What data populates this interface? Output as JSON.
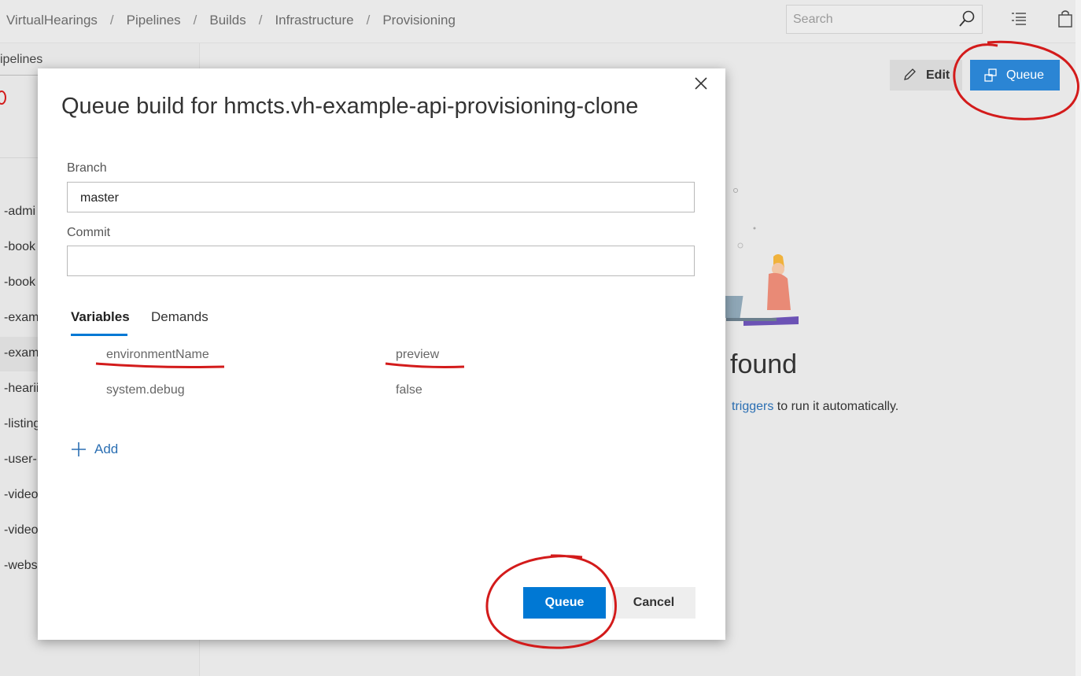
{
  "header": {
    "breadcrumbs": [
      "VirtualHearings",
      "Pipelines",
      "Builds",
      "Infrastructure",
      "Provisioning"
    ],
    "search_placeholder": "Search"
  },
  "sidebar": {
    "title": "ipelines",
    "items": [
      {
        "label": "-admi"
      },
      {
        "label": "-book"
      },
      {
        "label": "-book"
      },
      {
        "label": "-exam"
      },
      {
        "label": "-exam",
        "selected": true
      },
      {
        "label": "-hearii"
      },
      {
        "label": "-listing"
      },
      {
        "label": "-user-"
      },
      {
        "label": "-video"
      },
      {
        "label": "-video"
      },
      {
        "label": "-websi"
      }
    ]
  },
  "toolbar": {
    "edit_label": "Edit",
    "queue_label": "Queue"
  },
  "background": {
    "heading": "found",
    "sub_link": "triggers",
    "sub_text": " to run it automatically."
  },
  "modal": {
    "title": "Queue build for hmcts.vh-example-api-provisioning-clone",
    "branch_label": "Branch",
    "branch_value": "master",
    "commit_label": "Commit",
    "commit_value": "",
    "tabs": [
      {
        "label": "Variables",
        "active": true
      },
      {
        "label": "Demands",
        "active": false
      }
    ],
    "variables": [
      {
        "name": "environmentName",
        "value": "preview"
      },
      {
        "name": "system.debug",
        "value": "false"
      }
    ],
    "add_label": "Add",
    "queue_label": "Queue",
    "cancel_label": "Cancel"
  },
  "colors": {
    "accent": "#0078d4",
    "annotation": "#d31b1b"
  }
}
